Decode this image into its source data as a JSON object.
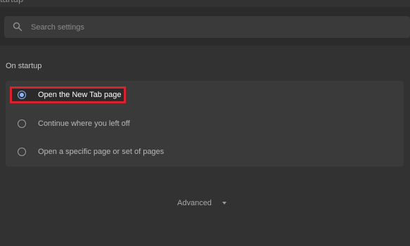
{
  "header": {
    "title_fragment": "tartup"
  },
  "search": {
    "placeholder": "Search settings"
  },
  "on_startup": {
    "title": "On startup",
    "options": [
      {
        "label": "Open the New Tab page",
        "selected": true
      },
      {
        "label": "Continue where you left off",
        "selected": false
      },
      {
        "label": "Open a specific page or set of pages",
        "selected": false
      }
    ]
  },
  "advanced": {
    "label": "Advanced"
  },
  "colors": {
    "background": "#323232",
    "card": "#3a3a3a",
    "accent_blue": "#8ab4f8",
    "highlight_red": "#d7232e"
  }
}
